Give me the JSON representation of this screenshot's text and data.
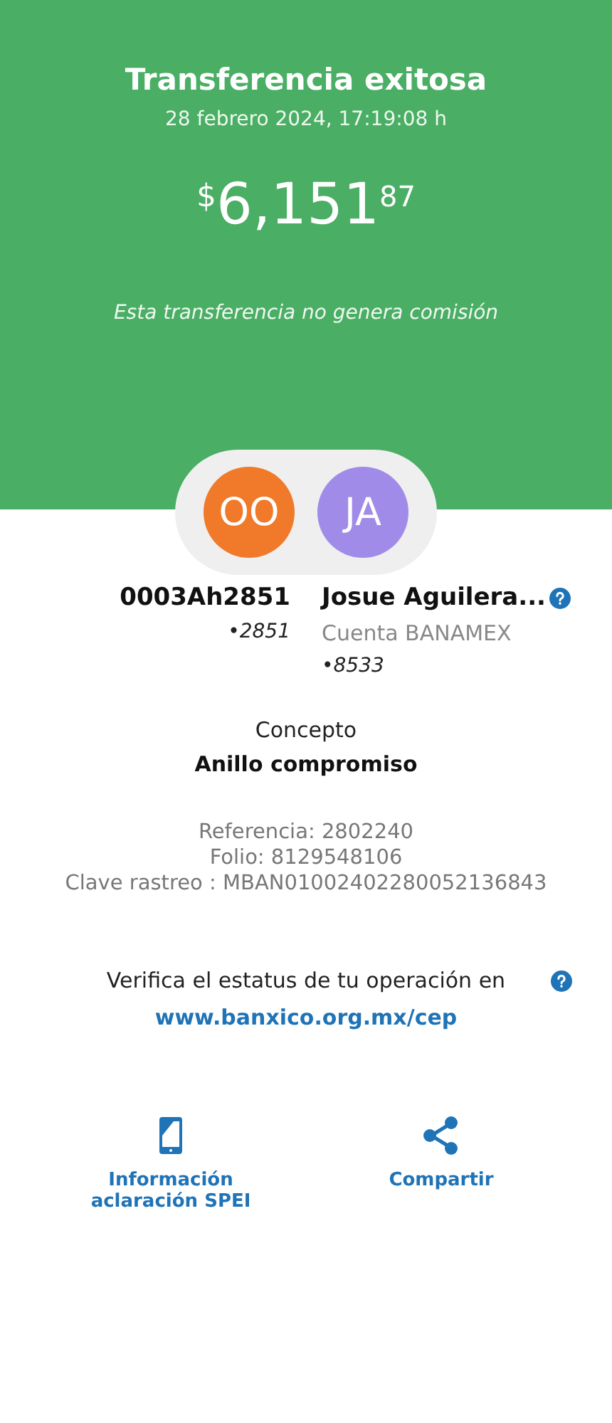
{
  "header": {
    "title": "Transferencia exitosa",
    "datetime": "28 febrero 2024, 17:19:08 h",
    "amount": {
      "currency": "$",
      "integer": "6,151",
      "cents": "87"
    },
    "note": "Esta transferencia no genera comisión"
  },
  "parties": [
    {
      "initials": "OO",
      "color": "#f07a2a",
      "name": "0003Ah2851",
      "account": "•2851",
      "help": false
    },
    {
      "initials": "JA",
      "color": "#a08ce8",
      "name": "Josue Aguilera...",
      "bank": "Cuenta BANAMEX",
      "account": "•8533",
      "help": true
    }
  ],
  "concept": {
    "label": "Concepto",
    "value": "Anillo compromiso"
  },
  "details": [
    "Referencia: 2802240",
    "Folio: 8129548106",
    "Clave rastreo : MBAN01002402280052136843"
  ],
  "verify": {
    "text": "Verifica el estatus de tu operación en",
    "link": "www.banxico.org.mx/cep"
  },
  "actions": [
    {
      "kind": "phone",
      "label": "Información aclaración SPEI"
    },
    {
      "kind": "share",
      "label": "Compartir"
    }
  ]
}
